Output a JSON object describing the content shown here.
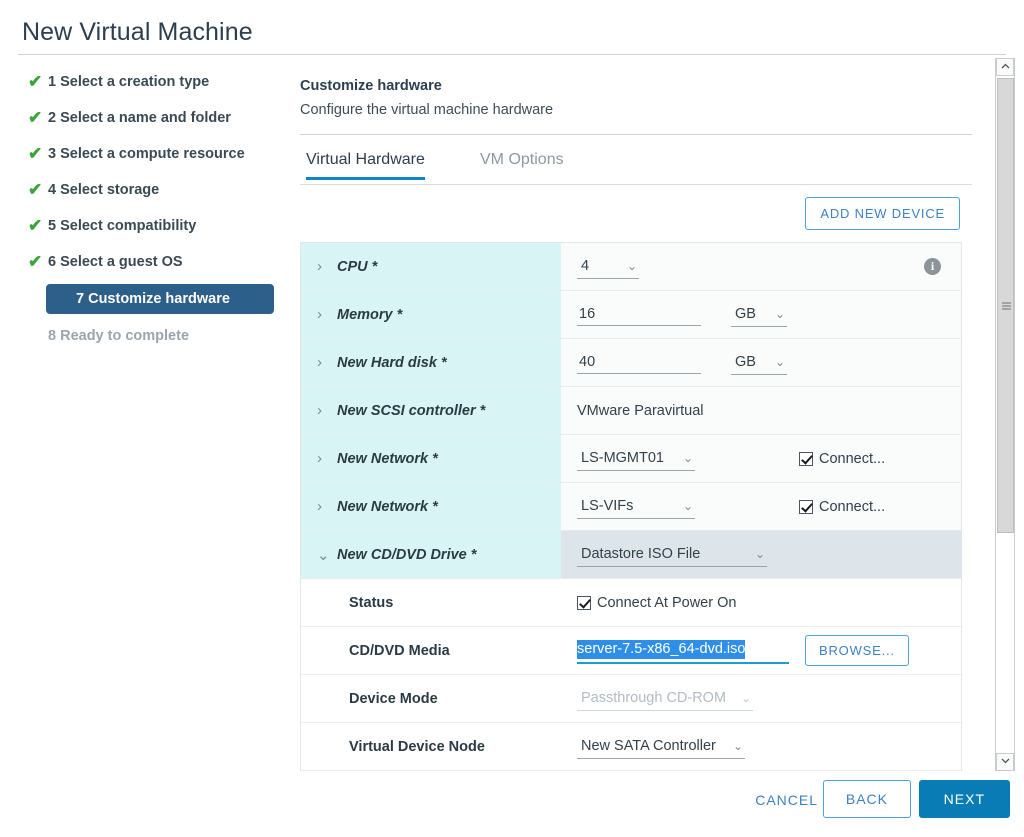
{
  "window": {
    "title": "New Virtual Machine"
  },
  "sidebar": {
    "steps": [
      {
        "label": "1 Select a creation type",
        "state": "done"
      },
      {
        "label": "2 Select a name and folder",
        "state": "done"
      },
      {
        "label": "3 Select a compute resource",
        "state": "done"
      },
      {
        "label": "4 Select storage",
        "state": "done"
      },
      {
        "label": "5 Select compatibility",
        "state": "done"
      },
      {
        "label": "6 Select a guest OS",
        "state": "done"
      },
      {
        "label": "7 Customize hardware",
        "state": "active"
      },
      {
        "label": "8 Ready to complete",
        "state": "pending"
      }
    ],
    "check_glyph": "✔"
  },
  "main": {
    "heading": "Customize hardware",
    "subheading": "Configure the virtual machine hardware",
    "tabs": [
      {
        "label": "Virtual Hardware",
        "selected": true
      },
      {
        "label": "VM Options",
        "selected": false
      }
    ],
    "add_device_label": "ADD NEW DEVICE",
    "rows": [
      {
        "label": "CPU *",
        "chevron": "›",
        "kind": "select-info",
        "value": "4",
        "info_glyph": "i"
      },
      {
        "label": "Memory *",
        "chevron": "›",
        "kind": "number-unit",
        "value": "16",
        "unit": "GB"
      },
      {
        "label": "New Hard disk *",
        "chevron": "›",
        "kind": "number-unit",
        "value": "40",
        "unit": "GB"
      },
      {
        "label": "New SCSI controller *",
        "chevron": "›",
        "kind": "plain",
        "value": "VMware Paravirtual"
      },
      {
        "label": "New Network *",
        "chevron": "›",
        "kind": "select-check",
        "value": "LS-MGMT01",
        "check_label": "Connect...",
        "checked": true
      },
      {
        "label": "New Network *",
        "chevron": "›",
        "kind": "select-check",
        "value": "LS-VIFs",
        "check_label": "Connect...",
        "checked": true
      },
      {
        "label": "New CD/DVD Drive *",
        "chevron": "⌄",
        "kind": "select",
        "value": "Datastore ISO File",
        "selected": true
      },
      {
        "label": "Status",
        "kind": "checkbox",
        "check_label": "Connect At Power On",
        "checked": true,
        "sub": true
      },
      {
        "label": "CD/DVD Media",
        "kind": "media",
        "value": "server-7.5-x86_64-dvd.iso",
        "browse_label": "BROWSE...",
        "sub": true
      },
      {
        "label": "Device Mode",
        "kind": "select-disabled",
        "value": "Passthrough CD-ROM",
        "sub": true
      },
      {
        "label": "Virtual Device Node",
        "kind": "select",
        "value": "New SATA Controller",
        "sub": true
      }
    ],
    "caret_glyph": "⌄"
  },
  "scrollbar": {
    "up_glyph": "︿",
    "down_glyph": "﹀"
  },
  "footer": {
    "cancel_label": "CANCEL",
    "back_label": "BACK",
    "next_label": "NEXT"
  },
  "colors": {
    "accent": "#0a7cb5",
    "link": "#3d82c4",
    "active_step_bg": "#2d5f8b",
    "row_label_bg": "#d8f4f4",
    "row_selected_bg": "#dde5ea",
    "check_green": "#3ba53b",
    "selection_blue": "#2f8fe8"
  }
}
